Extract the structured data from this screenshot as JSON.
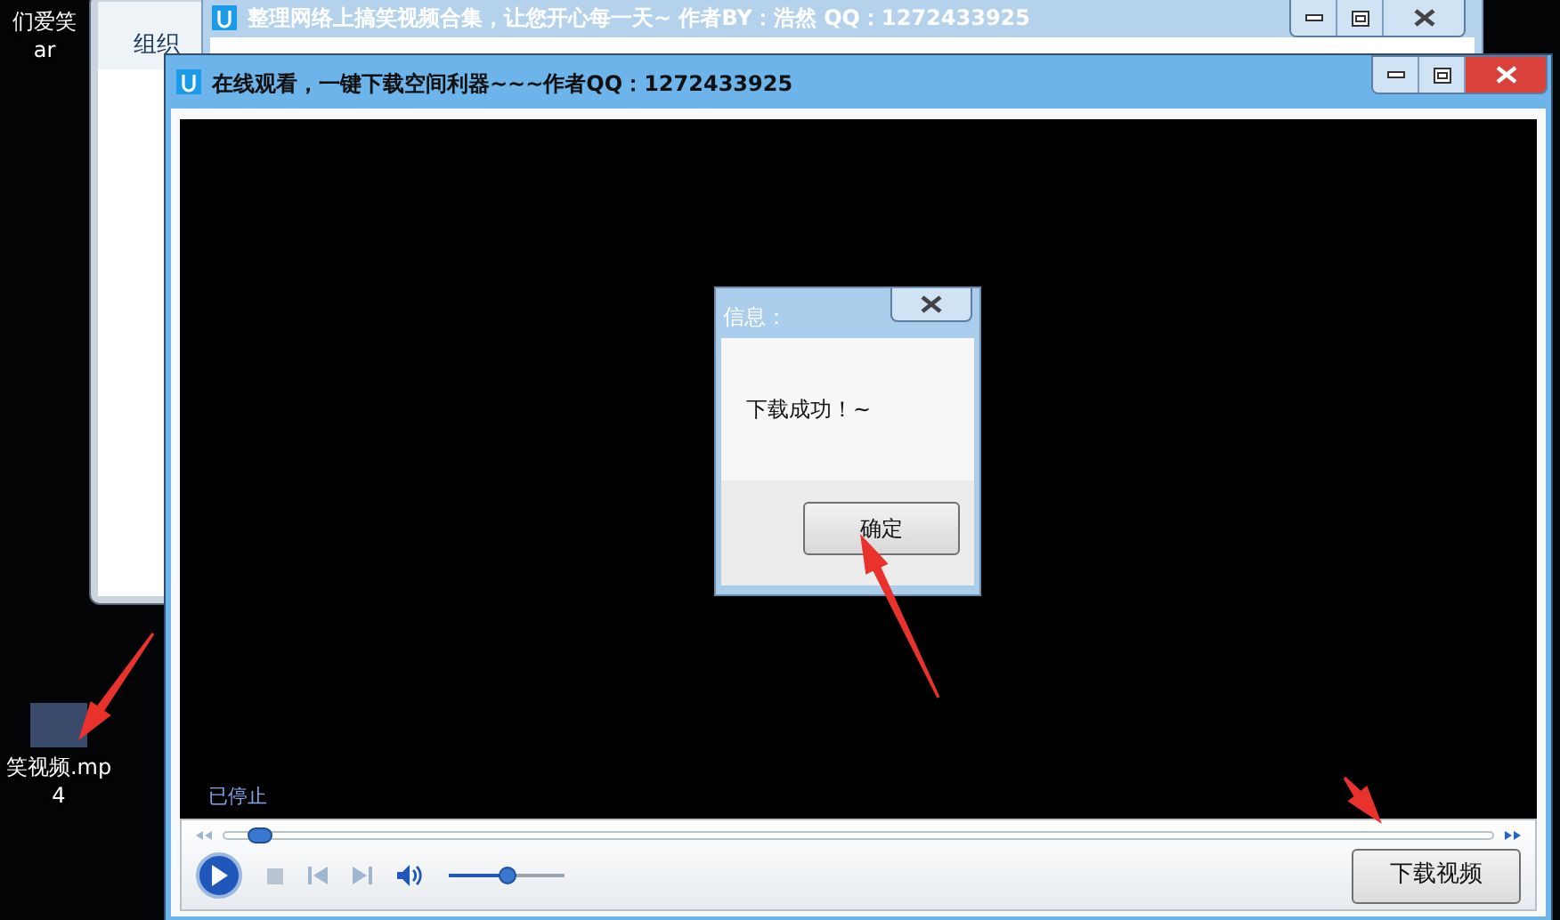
{
  "desktop": {
    "top_label": "们爱笑",
    "top_label_2": "ar",
    "file_label": "笑视频.mp",
    "file_label_2": "4"
  },
  "explorer_window": {
    "toolbar_item": "组织"
  },
  "back_window": {
    "title": "整理网络上搞笑视频合集，让您开心每一天~  作者BY：浩然 QQ：1272433925"
  },
  "main_window": {
    "title": "在线观看，一键下载空间利器~~~作者QQ：1272433925",
    "status": "已停止",
    "seek": {
      "level": 0.02
    },
    "volume": {
      "level": 0.5
    },
    "download_button": "下载视频"
  },
  "dialog": {
    "title": "信息：",
    "message": "下载成功！~",
    "ok_button": "确定"
  }
}
